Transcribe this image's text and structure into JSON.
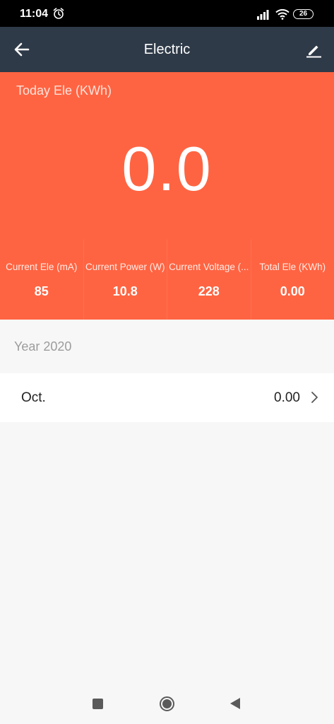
{
  "status_bar": {
    "time": "11:04",
    "battery": "26"
  },
  "app_bar": {
    "title": "Electric"
  },
  "hero": {
    "label": "Today Ele (KWh)",
    "value": "0.0"
  },
  "stats": [
    {
      "label": "Current Ele (mA)",
      "value": "85"
    },
    {
      "label": "Current Power (W)",
      "value": "10.8"
    },
    {
      "label": "Current Voltage (...",
      "value": "228"
    },
    {
      "label": "Total Ele (KWh)",
      "value": "0.00"
    }
  ],
  "history": {
    "year_label": "Year 2020",
    "months": [
      {
        "name": "Oct.",
        "value": "0.00"
      }
    ]
  },
  "colors": {
    "app_bar": "#2f3a48",
    "accent": "#ff6442",
    "background": "#f7f7f7"
  },
  "icons": [
    "alarm-icon",
    "signal-icon",
    "wifi-icon",
    "battery-icon",
    "back-arrow-icon",
    "edit-pencil-icon",
    "chevron-right-icon",
    "nav-recent-icon",
    "nav-home-icon",
    "nav-back-icon"
  ]
}
